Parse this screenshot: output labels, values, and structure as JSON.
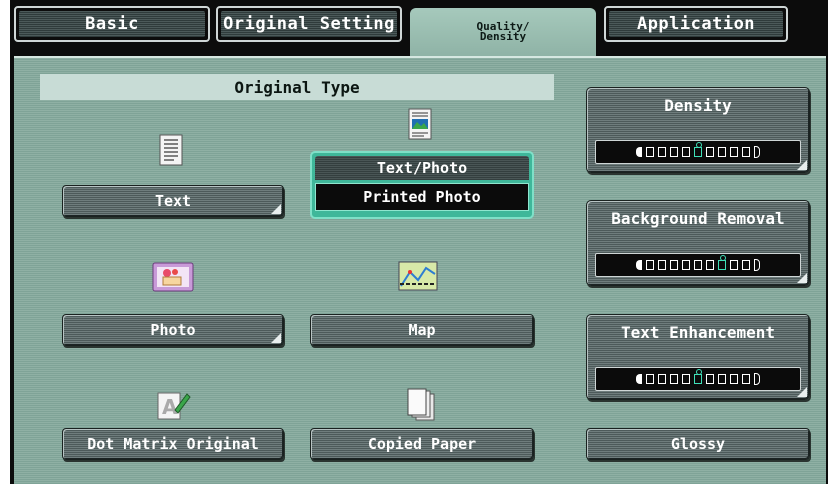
{
  "tabs": {
    "basic": "Basic",
    "original_setting": "Original Setting",
    "quality_density_line1": "Quality/",
    "quality_density_line2": "Density",
    "application": "Application"
  },
  "original_type": {
    "header": "Original Type",
    "text": "Text",
    "text_photo": "Text/Photo",
    "printed_photo": "Printed Photo",
    "photo": "Photo",
    "map": "Map",
    "dot_matrix": "Dot Matrix Original",
    "copied_paper": "Copied Paper"
  },
  "right_panel": {
    "density": {
      "label": "Density",
      "steps": 9,
      "selected": 5
    },
    "background_removal": {
      "label": "Background Removal",
      "steps": 9,
      "selected": 7
    },
    "text_enhancement": {
      "label": "Text Enhancement",
      "steps": 9,
      "selected": 5
    },
    "glossy": "Glossy"
  },
  "colors": {
    "accent": "#3fb79a",
    "panel": "#8fb0a4",
    "selected_tab": "#a6c9bc"
  }
}
